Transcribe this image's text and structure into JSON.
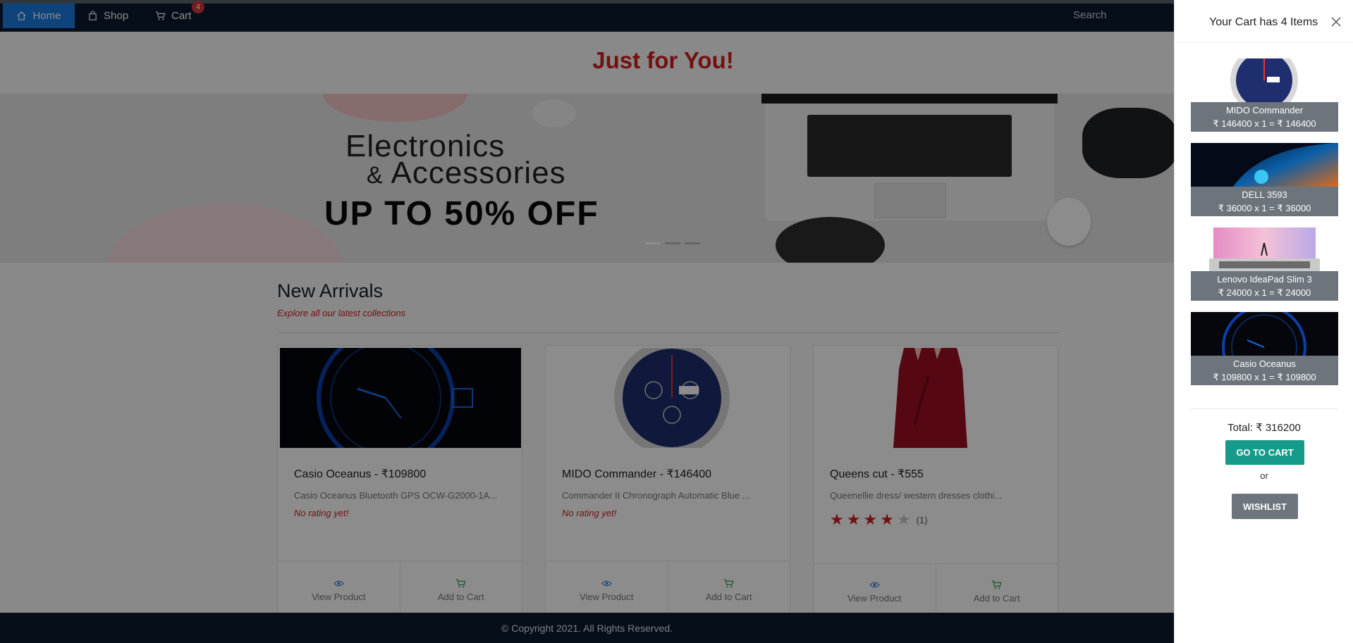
{
  "nav": {
    "home": "Home",
    "shop": "Shop",
    "cart": "Cart",
    "cart_count": "4",
    "search_placeholder": "Search"
  },
  "hero": {
    "title": "Just for You!",
    "banner_line1": "Electronics",
    "banner_line2_amp": "&",
    "banner_line2": "Accessories",
    "banner_line3": "UP TO 50% OFF"
  },
  "new_arrivals": {
    "title": "New Arrivals",
    "subtitle": "Explore all our latest collections",
    "products": [
      {
        "title": "Casio Oceanus - ₹109800",
        "desc": "Casio Oceanus Bluetooth GPS OCW-G2000-1A...",
        "rating": "No rating yet!",
        "view": "View Product",
        "add": "Add to Cart"
      },
      {
        "title": "MIDO Commander - ₹146400",
        "desc": "Commander II Chronograph Automatic Blue ...",
        "rating": "No rating yet!",
        "view": "View Product",
        "add": "Add to Cart"
      },
      {
        "title": "Queens cut - ₹555",
        "desc": "Queenellie dress/ western dresses clothi...",
        "stars": 4,
        "rating_count": "(1)",
        "view": "View Product",
        "add": "Add to Cart"
      }
    ]
  },
  "footer": {
    "text": "© Copyright 2021. All Rights Reserved."
  },
  "cart_panel": {
    "title": "Your Cart has 4 Items",
    "items": [
      {
        "name": "MIDO Commander",
        "line": "₹ 146400 x 1 = ₹ 146400"
      },
      {
        "name": "DELL 3593",
        "line": "₹ 36000 x 1 = ₹ 36000"
      },
      {
        "name": "Lenovo IdeaPad Slim 3",
        "line": "₹ 24000 x 1 = ₹ 24000"
      },
      {
        "name": "Casio Oceanus",
        "line": "₹ 109800 x 1 = ₹ 109800"
      }
    ],
    "total": "Total: ₹ 316200",
    "go_to_cart": "GO TO CART",
    "or": "or",
    "wishlist": "WISHLIST"
  },
  "colors": {
    "navbar": "#0b1a2f",
    "accent_red": "#d11f1f",
    "home_active": "#1d7ae0",
    "go_to_cart": "#169b8a",
    "wishlist": "#6d747c"
  }
}
